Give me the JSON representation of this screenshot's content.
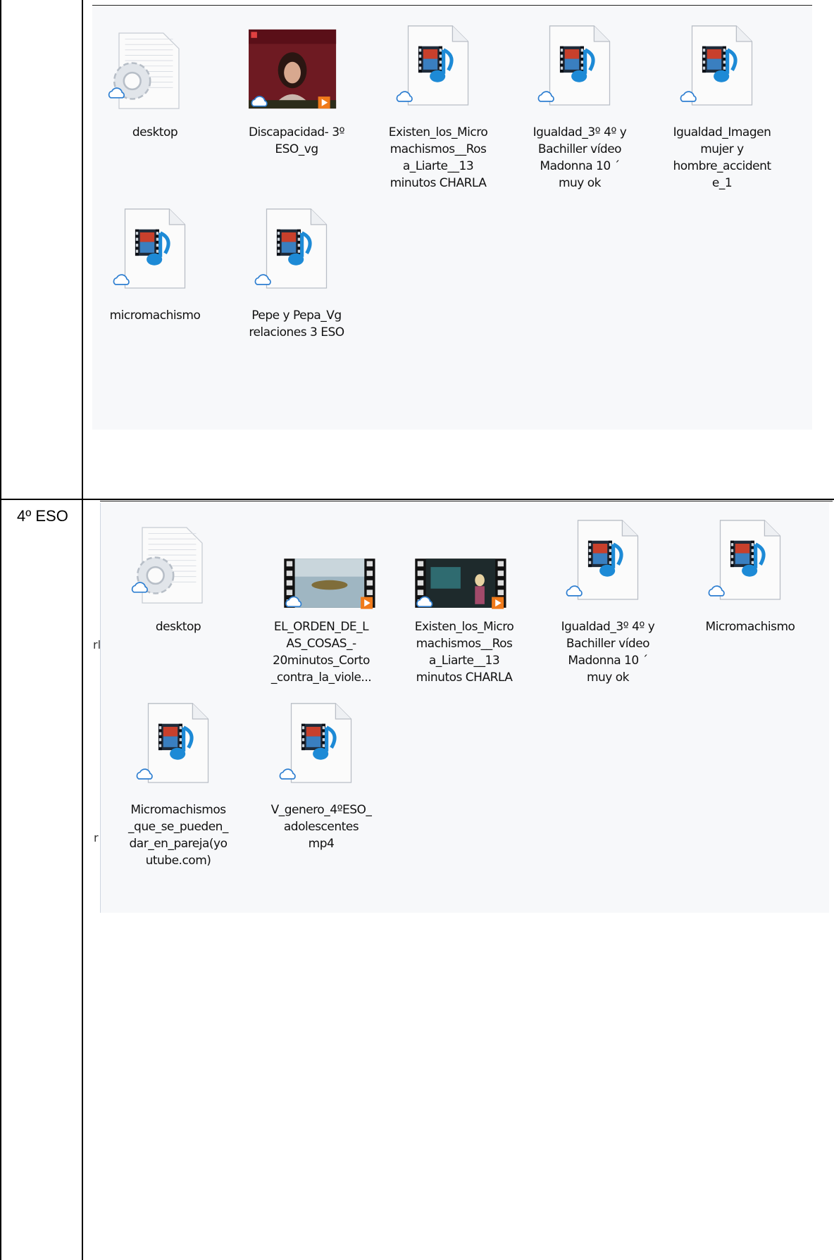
{
  "section_label": "4º ESO",
  "top_group": [
    {
      "kind": "config",
      "lines": [
        "desktop"
      ]
    },
    {
      "kind": "photo",
      "lines": [
        "Discapacidad- 3º",
        "ESO_vg"
      ]
    },
    {
      "kind": "media",
      "lines": [
        "Existen_los_Micro",
        "machismos__Ros",
        "a_Liarte__13",
        "minutos CHARLA"
      ]
    },
    {
      "kind": "media",
      "lines": [
        "Igualdad_3º 4º y",
        "Bachiller vídeo",
        "Madonna 10 ´",
        "muy ok"
      ]
    },
    {
      "kind": "media",
      "lines": [
        "Igualdad_Imagen",
        "mujer y",
        "hombre_accident",
        "e_1"
      ]
    },
    {
      "kind": "media",
      "lines": [
        "micromachismo"
      ]
    },
    {
      "kind": "media",
      "lines": [
        "Pepe y Pepa_Vg",
        "relaciones 3 ESO"
      ]
    }
  ],
  "bottom_group": [
    {
      "kind": "config",
      "lines": [
        "desktop"
      ]
    },
    {
      "kind": "film-water",
      "lines": [
        "EL_ORDEN_DE_L",
        "AS_COSAS_-",
        "20minutos_Corto",
        "_contra_la_viole..."
      ]
    },
    {
      "kind": "film-talk",
      "lines": [
        "Existen_los_Micro",
        "machismos__Ros",
        "a_Liarte__13",
        "minutos CHARLA"
      ]
    },
    {
      "kind": "media",
      "lines": [
        "Igualdad_3º 4º y",
        "Bachiller vídeo",
        "Madonna 10 ´",
        "muy ok"
      ]
    },
    {
      "kind": "media",
      "lines": [
        "Micromachismo"
      ]
    },
    {
      "kind": "media",
      "lines": [
        "Micromachismos",
        "_que_se_pueden_",
        "dar_en_pareja(yo",
        "utube.com)"
      ]
    },
    {
      "kind": "media",
      "lines": [
        "V_genero_4ºESO_",
        "adolescentes",
        "mp4"
      ]
    }
  ],
  "edge_marks": [
    "rl",
    "r"
  ],
  "colors": {
    "cloud": "#2f7fd1",
    "play": "#f07a1a",
    "panel": "#f7f8fa"
  }
}
